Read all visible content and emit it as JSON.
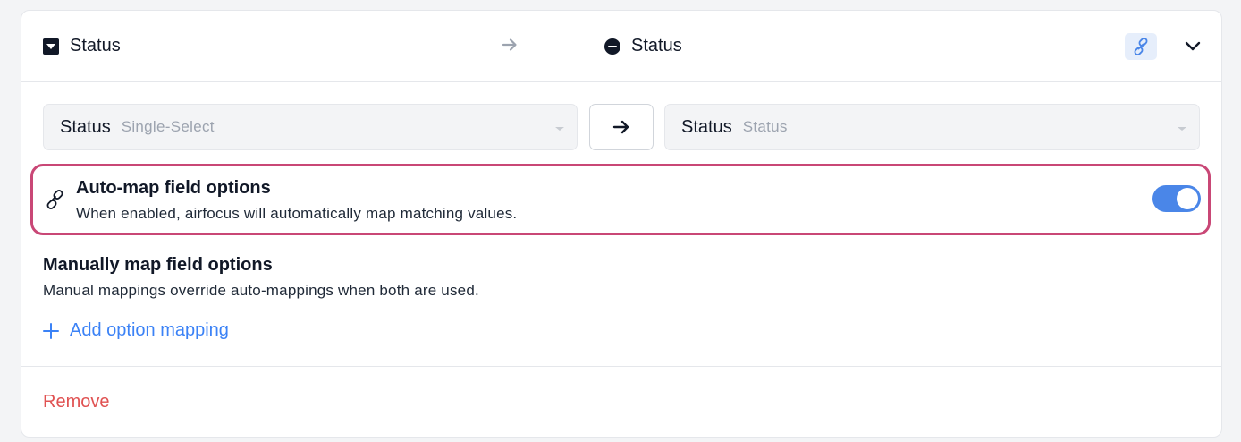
{
  "header": {
    "source_field": "Status",
    "target_field": "Status",
    "link_icon": "link-icon",
    "expand_icon": "chevron-down-icon"
  },
  "mapping": {
    "source": {
      "name": "Status",
      "type": "Single-Select"
    },
    "target": {
      "name": "Status",
      "type": "Status"
    }
  },
  "automap": {
    "title": "Auto-map field options",
    "description": "When enabled, airfocus will automatically map matching values.",
    "enabled": true
  },
  "manual": {
    "title": "Manually map field options",
    "description": "Manual mappings override auto-mappings when both are used.",
    "add_label": "Add option mapping"
  },
  "footer": {
    "remove_label": "Remove"
  },
  "colors": {
    "accent": "#4a86e8",
    "highlight": "#c94776",
    "danger": "#e05252"
  }
}
